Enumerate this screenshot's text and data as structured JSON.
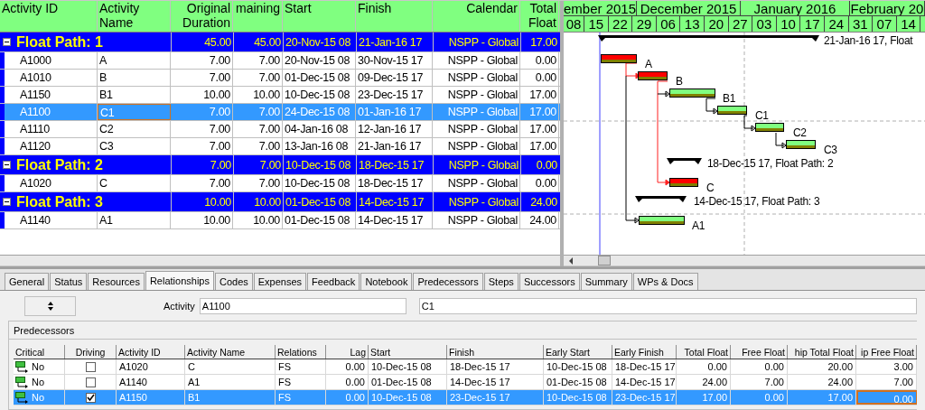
{
  "activity_table": {
    "columns": [
      "Activity ID",
      "Activity Name",
      "Original Duration",
      "maining",
      "Start",
      "Finish",
      "Calendar",
      "Total Float"
    ],
    "groups": [
      {
        "title": "Float Path: 1",
        "expanded": true,
        "original_duration": "45.00",
        "remaining": "45.00",
        "start": "20-Nov-15 08",
        "finish": "21-Jan-16 17",
        "calendar": "NSPP - Global",
        "total_float": "17.00",
        "rows": [
          {
            "id": "A1000",
            "name": "A",
            "original_duration": "7.00",
            "remaining": "7.00",
            "start": "20-Nov-15 08",
            "finish": "30-Nov-15 17",
            "calendar": "NSPP - Global",
            "total_float": "0.00",
            "selected": false
          },
          {
            "id": "A1010",
            "name": "B",
            "original_duration": "7.00",
            "remaining": "7.00",
            "start": "01-Dec-15 08",
            "finish": "09-Dec-15 17",
            "calendar": "NSPP - Global",
            "total_float": "0.00",
            "selected": false
          },
          {
            "id": "A1150",
            "name": "B1",
            "original_duration": "10.00",
            "remaining": "10.00",
            "start": "10-Dec-15 08",
            "finish": "23-Dec-15 17",
            "calendar": "NSPP - Global",
            "total_float": "17.00",
            "selected": false
          },
          {
            "id": "A1100",
            "name": "C1",
            "original_duration": "7.00",
            "remaining": "7.00",
            "start": "24-Dec-15 08",
            "finish": "01-Jan-16 17",
            "calendar": "NSPP - Global",
            "total_float": "17.00",
            "selected": true
          },
          {
            "id": "A1110",
            "name": "C2",
            "original_duration": "7.00",
            "remaining": "7.00",
            "start": "04-Jan-16 08",
            "finish": "12-Jan-16 17",
            "calendar": "NSPP - Global",
            "total_float": "17.00",
            "selected": false
          },
          {
            "id": "A1120",
            "name": "C3",
            "original_duration": "7.00",
            "remaining": "7.00",
            "start": "13-Jan-16 08",
            "finish": "21-Jan-16 17",
            "calendar": "NSPP - Global",
            "total_float": "17.00",
            "selected": false
          }
        ]
      },
      {
        "title": "Float Path: 2",
        "expanded": true,
        "original_duration": "7.00",
        "remaining": "7.00",
        "start": "10-Dec-15 08",
        "finish": "18-Dec-15 17",
        "calendar": "NSPP - Global",
        "total_float": "0.00",
        "rows": [
          {
            "id": "A1020",
            "name": "C",
            "original_duration": "7.00",
            "remaining": "7.00",
            "start": "10-Dec-15 08",
            "finish": "18-Dec-15 17",
            "calendar": "NSPP - Global",
            "total_float": "0.00",
            "selected": false
          }
        ]
      },
      {
        "title": "Float Path: 3",
        "expanded": true,
        "original_duration": "10.00",
        "remaining": "10.00",
        "start": "01-Dec-15 08",
        "finish": "14-Dec-15 17",
        "calendar": "NSPP - Global",
        "total_float": "24.00",
        "rows": [
          {
            "id": "A1140",
            "name": "A1",
            "original_duration": "10.00",
            "remaining": "10.00",
            "start": "01-Dec-15 08",
            "finish": "14-Dec-15 17",
            "calendar": "NSPP - Global",
            "total_float": "24.00",
            "selected": false
          }
        ]
      }
    ]
  },
  "gantt": {
    "months": [
      "ember 2015",
      "December 2015",
      "January 2016",
      "February 20"
    ],
    "weeks": [
      "08",
      "15",
      "22",
      "29",
      "06",
      "13",
      "20",
      "27",
      "03",
      "10",
      "17",
      "24",
      "31",
      "07",
      "14"
    ],
    "bars": [
      {
        "kind": "summary",
        "label": "21-Jan-16 17, Float"
      },
      {
        "kind": "task",
        "critical": true,
        "label": "A"
      },
      {
        "kind": "task",
        "critical": true,
        "label": "B"
      },
      {
        "kind": "task",
        "critical": false,
        "label": "B1"
      },
      {
        "kind": "task",
        "critical": false,
        "label": "C1"
      },
      {
        "kind": "task",
        "critical": false,
        "label": "C2"
      },
      {
        "kind": "task",
        "critical": false,
        "label": "C3"
      },
      {
        "kind": "summary",
        "label": "18-Dec-15 17, Float Path: 2"
      },
      {
        "kind": "task",
        "critical": true,
        "label": "C"
      },
      {
        "kind": "summary",
        "label": "14-Dec-15 17, Float Path: 3"
      },
      {
        "kind": "task",
        "critical": false,
        "label": "A1"
      }
    ]
  },
  "details": {
    "tabs": [
      {
        "label": "General",
        "selected": false
      },
      {
        "label": "Status",
        "selected": false
      },
      {
        "label": "Resources",
        "selected": false
      },
      {
        "label": "Relationships",
        "selected": true
      },
      {
        "label": "Codes",
        "selected": false
      },
      {
        "label": "Expenses",
        "selected": false
      },
      {
        "label": "Feedback",
        "selected": false
      },
      {
        "label": "Notebook",
        "selected": false
      },
      {
        "label": "Predecessors",
        "selected": false
      },
      {
        "label": "Steps",
        "selected": false
      },
      {
        "label": "Successors",
        "selected": false
      },
      {
        "label": "Summary",
        "selected": false
      },
      {
        "label": "WPs & Docs",
        "selected": false
      }
    ],
    "activity_label": "Activity",
    "activity_id": "A1100",
    "activity_name": "C1",
    "predecessors": {
      "title": "Predecessors",
      "columns": [
        "Critical",
        "Driving",
        "Activity ID",
        "Activity Name",
        "Relations",
        "Lag",
        "Start",
        "Finish",
        "Early Start",
        "Early Finish",
        "Total Float",
        "Free Float",
        "hip Total Float",
        "ip Free Float"
      ],
      "rows": [
        {
          "critical": "No",
          "driving": false,
          "id": "A1020",
          "name": "C",
          "relation": "FS",
          "lag": "0.00",
          "start": "10-Dec-15 08",
          "finish": "18-Dec-15 17",
          "early_start": "10-Dec-15 08",
          "early_finish": "18-Dec-15 17",
          "total_float": "0.00",
          "free_float": "0.00",
          "rel_total_float": "20.00",
          "rel_free_float": "3.00",
          "selected": false
        },
        {
          "critical": "No",
          "driving": false,
          "id": "A1140",
          "name": "A1",
          "relation": "FS",
          "lag": "0.00",
          "start": "01-Dec-15 08",
          "finish": "14-Dec-15 17",
          "early_start": "01-Dec-15 08",
          "early_finish": "14-Dec-15 17",
          "total_float": "24.00",
          "free_float": "7.00",
          "rel_total_float": "24.00",
          "rel_free_float": "7.00",
          "selected": false
        },
        {
          "critical": "No",
          "driving": true,
          "id": "A1150",
          "name": "B1",
          "relation": "FS",
          "lag": "0.00",
          "start": "10-Dec-15 08",
          "finish": "23-Dec-15 17",
          "early_start": "10-Dec-15 08",
          "early_finish": "23-Dec-15 17",
          "total_float": "17.00",
          "free_float": "0.00",
          "rel_total_float": "17.00",
          "rel_free_float": "0.00",
          "selected": true
        }
      ]
    }
  }
}
